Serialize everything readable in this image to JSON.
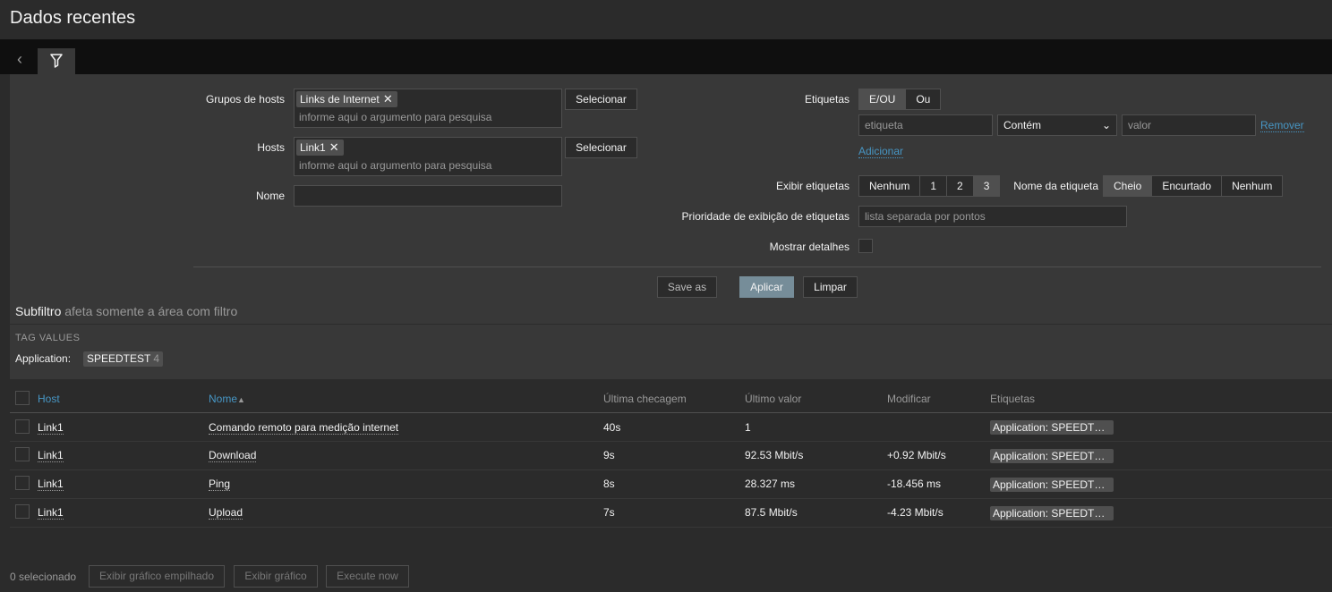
{
  "page": {
    "title": "Dados recentes"
  },
  "filter": {
    "host_groups_label": "Grupos de hosts",
    "host_groups_chip": "Links de Internet",
    "host_groups_placeholder": "informe aqui o argumento para pesquisa",
    "hosts_label": "Hosts",
    "hosts_chip": "Link1",
    "hosts_placeholder": "informe aqui o argumento para pesquisa",
    "name_label": "Nome",
    "name_value": "",
    "select_label": "Selecionar",
    "tags_label": "Etiquetas",
    "tags_mode": [
      "E/OU",
      "Ou"
    ],
    "tag_placeholder": "etiqueta",
    "tag_operator": "Contém",
    "value_placeholder": "valor",
    "remove_label": "Remover",
    "add_label": "Adicionar",
    "show_tags_label": "Exibir etiquetas",
    "show_tags_options": [
      "Nenhum",
      "1",
      "2",
      "3"
    ],
    "tag_name_label": "Nome da etiqueta",
    "tag_name_options": [
      "Cheio",
      "Encurtado",
      "Nenhum"
    ],
    "tag_priority_label": "Prioridade de exibição de etiquetas",
    "tag_priority_placeholder": "lista separada por pontos",
    "show_details_label": "Mostrar detalhes",
    "save_as": "Save as",
    "apply": "Aplicar",
    "reset": "Limpar"
  },
  "subfilter": {
    "title": "Subfiltro",
    "hint": "afeta somente a área com filtro",
    "section": "TAG VALUES",
    "tag_name": "Application:",
    "tag_value": "SPEEDTEST",
    "tag_count": "4"
  },
  "table": {
    "headers": [
      "Host",
      "Nome",
      "Última checagem",
      "Último valor",
      "Modificar",
      "Etiquetas"
    ],
    "sort_arrow": "▲",
    "rows": [
      {
        "host": "Link1",
        "name": "Comando remoto para medição internet",
        "last_check": "40s",
        "last_value": "1",
        "change": "",
        "tags": "Application: SPEEDTEST"
      },
      {
        "host": "Link1",
        "name": "Download",
        "last_check": "9s",
        "last_value": "92.53 Mbit/s",
        "change": "+0.92 Mbit/s",
        "tags": "Application: SPEEDTEST"
      },
      {
        "host": "Link1",
        "name": "Ping",
        "last_check": "8s",
        "last_value": "28.327 ms",
        "change": "-18.456 ms",
        "tags": "Application: SPEEDTEST"
      },
      {
        "host": "Link1",
        "name": "Upload",
        "last_check": "7s",
        "last_value": "87.5 Mbit/s",
        "change": "-4.23 Mbit/s",
        "tags": "Application: SPEEDTEST"
      }
    ]
  },
  "footer": {
    "selected": "0 selecionado",
    "stacked_graph": "Exibir gráfico empilhado",
    "graph": "Exibir gráfico",
    "execute": "Execute now"
  }
}
